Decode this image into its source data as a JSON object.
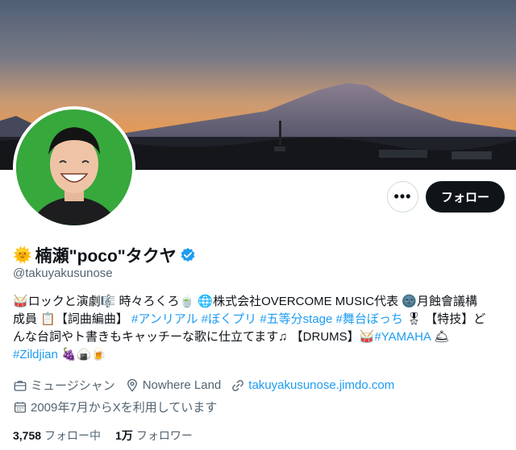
{
  "header": {
    "more_label": "•••",
    "follow_label": "フォロー"
  },
  "profile": {
    "name_emoji": "🌞",
    "name": "楠瀬\"poco\"タクヤ",
    "handle": "@takuyakusunose"
  },
  "bio": {
    "line1": [
      "🥁",
      "ロックと演劇",
      "🎼",
      " 時々ろくろ",
      "🍵",
      " ",
      "🌐",
      "株式会社OVERCOME MUSIC代表 ",
      "🌚",
      "月蝕會議構"
    ],
    "line2_plain1": "成員 ",
    "line2_emoji1": "📋",
    "line2_plain2": "【詞曲編曲】 ",
    "hashtags1": [
      "#アンリアル",
      "#ぼくプリ",
      "#五等分stage",
      "#舞台ぼっち"
    ],
    "medal": "🎖",
    "line2_plain3": "【特技】ど",
    "line3_plain": "んな台詞やト書きもキャッチーな歌に仕立てます♫ 【DRUMS】",
    "line3_emoji": "🥁",
    "hashtag_yamaha": "#YAMAHA",
    "bell": "🛎",
    "hashtag_zildjian": "#Zildjian",
    "tail_emojis": [
      "🍇",
      "🍙",
      "🍺"
    ]
  },
  "meta": {
    "category": "ミュージシャン",
    "location": "Nowhere Land",
    "website": "takuyakusunose.jimdo.com",
    "joined": "2009年7月からXを利用しています"
  },
  "stats": {
    "following_count": "3,758",
    "following_label": "フォロー中",
    "followers_count": "1万",
    "followers_label": "フォロワー"
  },
  "colors": {
    "accent": "#1d9bf0",
    "text": "#0f1419",
    "secondary": "#536471",
    "follow_bg": "#0f1419"
  }
}
